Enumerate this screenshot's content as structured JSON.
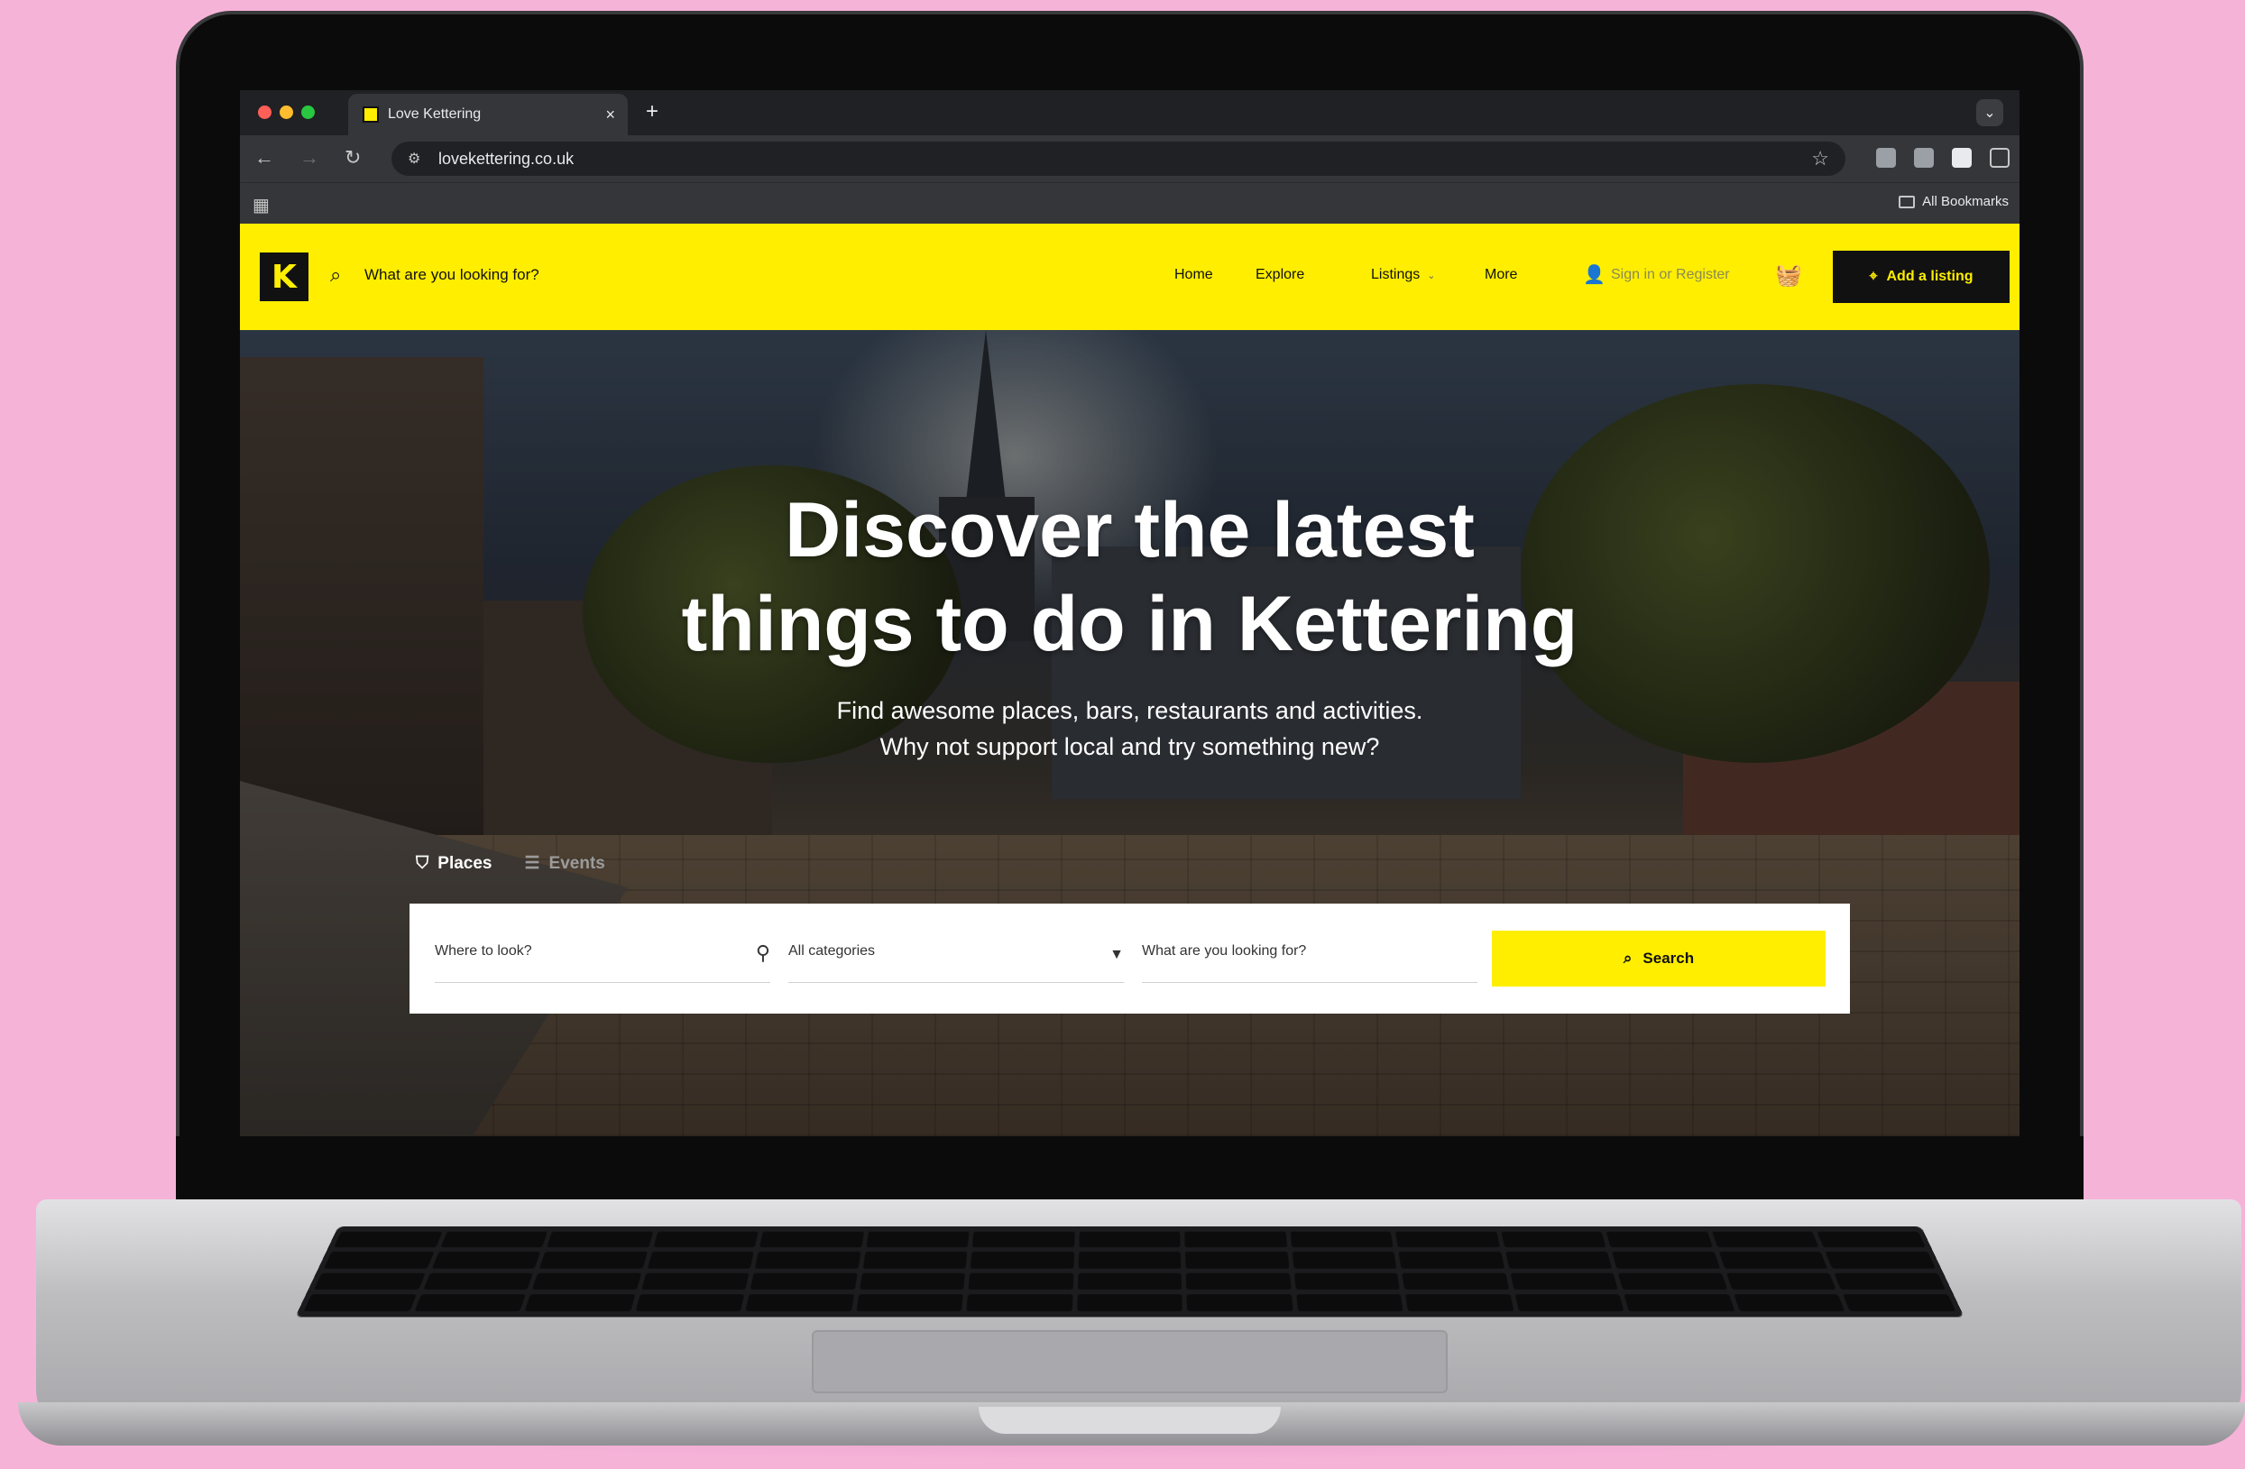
{
  "browser": {
    "tab_title": "Love Kettering",
    "tab_close": "×",
    "new_tab": "+",
    "tab_menu_icon": "chevron-down-icon",
    "url": "lovekettering.co.uk",
    "bookmarks_label": "All Bookmarks"
  },
  "header": {
    "logo_text": "K",
    "search_placeholder": "What are you looking for?",
    "nav": [
      "Home",
      "Explore",
      "Listings",
      "More"
    ],
    "listings_caret": "⌄",
    "signin": "Sign in or Register",
    "add_listing": "Add a listing",
    "accent_color": "#ffee00"
  },
  "hero": {
    "title_line1": "Discover the latest",
    "title_line2": "things to do in Kettering",
    "subtitle_line1": "Find awesome places, bars, restaurants and activities.",
    "subtitle_line2": "Why not support local and try something new?",
    "tabs": [
      "Places",
      "Events"
    ]
  },
  "search": {
    "where_placeholder": "Where to look?",
    "category_selected": "All categories",
    "what_placeholder": "What are you looking for?",
    "button_label": "Search"
  }
}
